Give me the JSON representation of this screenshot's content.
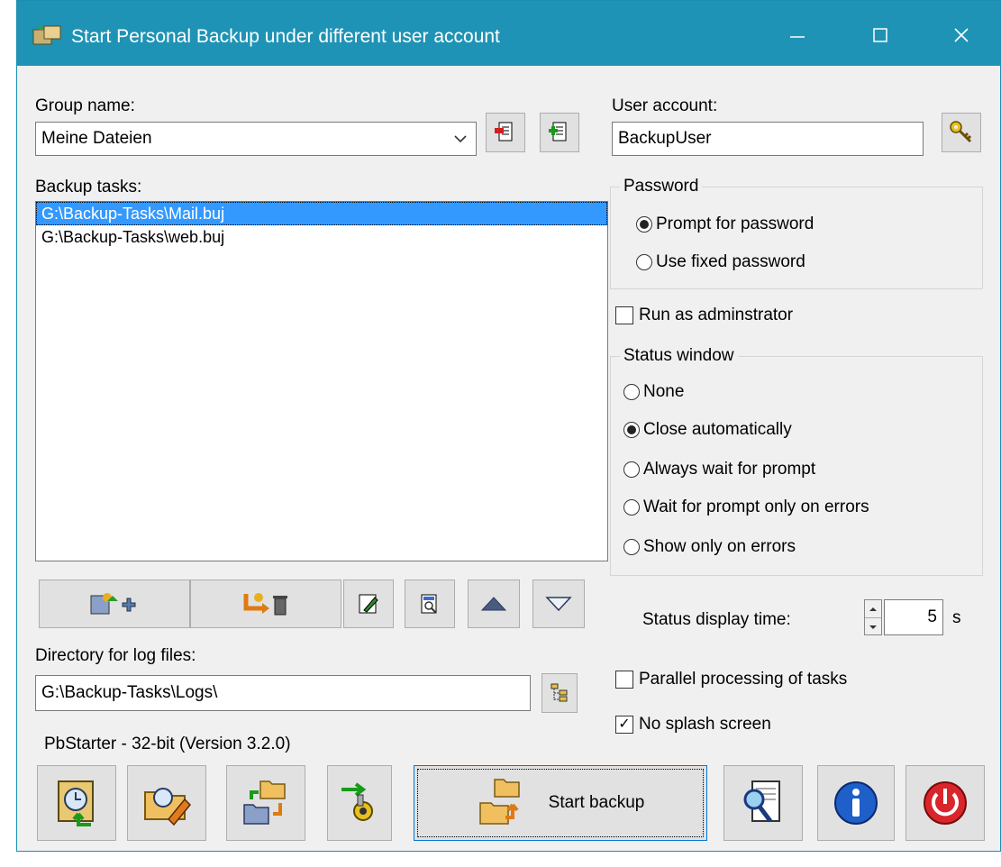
{
  "window": {
    "title": "Start Personal Backup under different user account"
  },
  "left": {
    "group_label": "Group name:",
    "group_value": "Meine Dateien",
    "tasks_label": "Backup tasks:",
    "tasks": [
      "G:\\Backup-Tasks\\Mail.buj",
      "G:\\Backup-Tasks\\web.buj"
    ],
    "selected_task_index": 0,
    "log_label": "Directory for log files:",
    "log_value": "G:\\Backup-Tasks\\Logs\\",
    "version_text": "PbStarter - 32-bit (Version 3.2.0)"
  },
  "right": {
    "user_label": "User account:",
    "user_value": "BackupUser",
    "password_group": "Password",
    "password_options": [
      "Prompt for password",
      "Use fixed password"
    ],
    "password_selected": 0,
    "run_admin_label": "Run as adminstrator",
    "run_admin_checked": false,
    "status_group": "Status window",
    "status_options": [
      "None",
      "Close automatically",
      "Always wait for prompt",
      "Wait for prompt only on errors",
      "Show only on errors"
    ],
    "status_selected": 1,
    "display_time_label": "Status display time:",
    "display_time_value": "5",
    "display_time_unit": "s",
    "parallel_label": "Parallel processing of tasks",
    "parallel_checked": false,
    "splash_label": "No splash screen",
    "splash_checked": true
  },
  "bottom": {
    "start_label": "Start backup"
  },
  "colors": {
    "titlebar": "#1f93b5",
    "selection": "#3399ff",
    "accent_red": "#d9262b",
    "info_blue": "#1e5fc9"
  }
}
